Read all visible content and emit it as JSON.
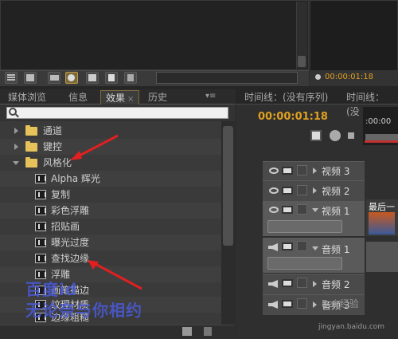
{
  "project": {
    "toolbar_icons": [
      "list-view-icon",
      "icon-view-icon",
      "automate-icon",
      "find-icon",
      "folder-icon",
      "new-item-icon",
      "clear-icon"
    ]
  },
  "monitor": {
    "timecode": "00:00:01:18"
  },
  "effects_panel": {
    "tabs": [
      {
        "label": "媒体浏览",
        "active": false
      },
      {
        "label": "信息",
        "active": false
      },
      {
        "label": "效果",
        "active": true
      },
      {
        "label": "历史",
        "active": false
      }
    ],
    "tab_close": "×",
    "search_placeholder": "",
    "folders": [
      {
        "label": "通道",
        "expanded": false
      },
      {
        "label": "键控",
        "expanded": false
      },
      {
        "label": "风格化",
        "expanded": true
      }
    ],
    "effects": [
      "Alpha 辉光",
      "复制",
      "彩色浮雕",
      "招贴画",
      "曝光过度",
      "查找边缘",
      "浮雕",
      "画笔描边",
      "纹理材质",
      "边缘粗糙"
    ]
  },
  "timeline": {
    "tabs": [
      "时间线：(没有序列)",
      "时间线：(没"
    ],
    "timecode": "00:00:01:18",
    "ruler_time": ":00:00",
    "tracks": [
      {
        "label": "视频 3",
        "type": "video",
        "expanded": false
      },
      {
        "label": "视频 2",
        "type": "video",
        "expanded": false
      },
      {
        "label": "视频 1",
        "type": "video",
        "expanded": true
      },
      {
        "label": "音频 1",
        "type": "audio",
        "expanded": true
      },
      {
        "label": "音频 2",
        "type": "audio",
        "expanded": false
      },
      {
        "label": "音频 3",
        "type": "audio",
        "expanded": false
      }
    ],
    "clip_title": "最后一"
  },
  "watermark": {
    "line1": "百度id",
    "line2": "无论奈与你相约",
    "logo": "Bai 经验",
    "url": "jingyan.baidu.com"
  },
  "colors": {
    "timecode": "#e0a020",
    "arrow": "#e02020",
    "watermark": "#4a5ad8"
  }
}
